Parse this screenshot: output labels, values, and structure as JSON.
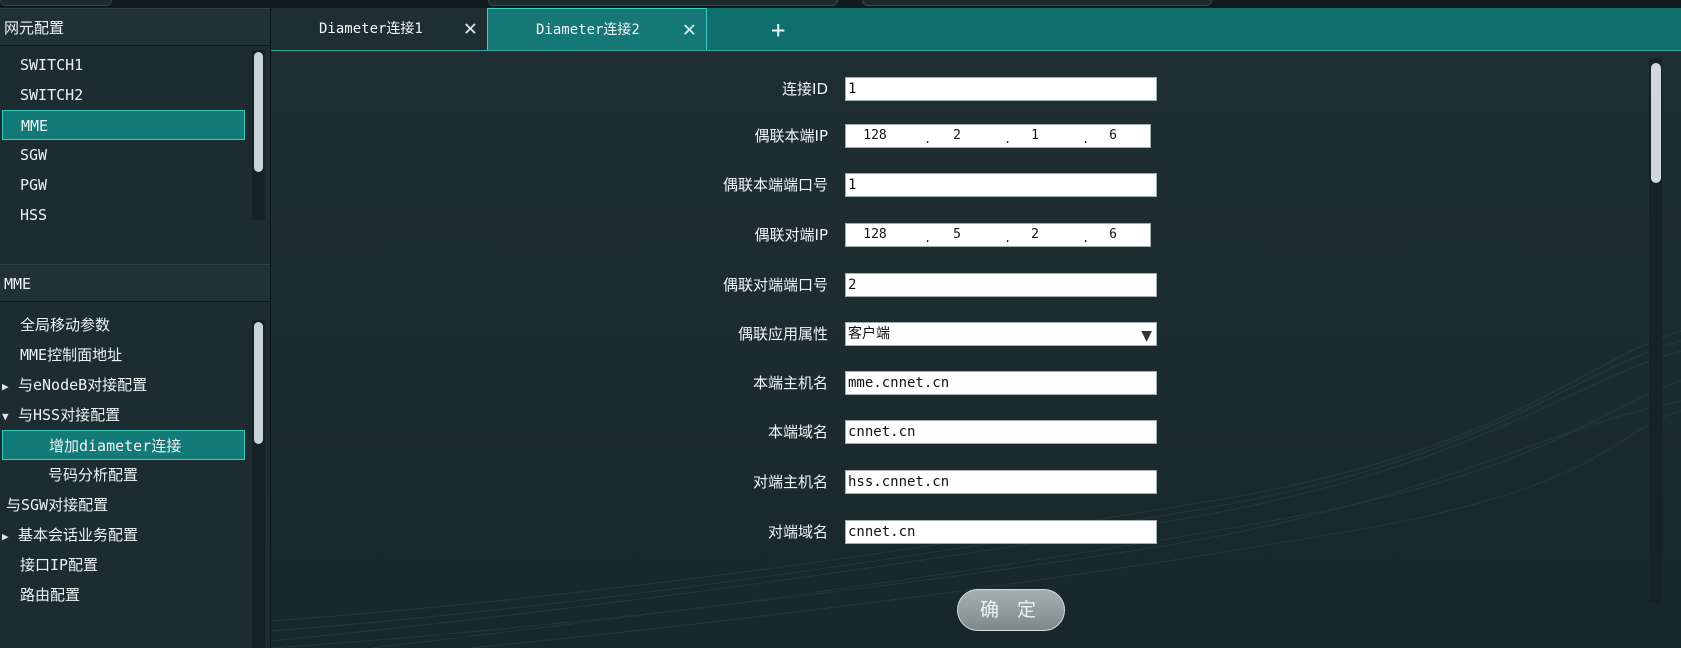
{
  "left_panel": {
    "ne_section": {
      "title": "网元配置",
      "items": [
        "SWITCH1",
        "SWITCH2",
        "MME",
        "SGW",
        "PGW",
        "HSS"
      ],
      "selected": "MME"
    },
    "mme_section": {
      "title": "MME",
      "items": [
        {
          "label": "全局移动参数",
          "arrow": ""
        },
        {
          "label": "MME控制面地址",
          "arrow": ""
        },
        {
          "label": "与eNodeB对接配置",
          "arrow": "▶"
        },
        {
          "label": "与HSS对接配置",
          "arrow": "▼"
        },
        {
          "label": "增加diameter连接",
          "arrow": ""
        },
        {
          "label": "号码分析配置",
          "arrow": ""
        },
        {
          "label": "与SGW对接配置",
          "arrow": ""
        },
        {
          "label": "基本会话业务配置",
          "arrow": "▶"
        },
        {
          "label": "接口IP配置",
          "arrow": ""
        },
        {
          "label": "路由配置",
          "arrow": ""
        }
      ],
      "selected": "增加diameter连接"
    }
  },
  "tabs": [
    {
      "label": "Diameter连接1",
      "close": "✕"
    },
    {
      "label": "Diameter连接2",
      "close": "✕"
    }
  ],
  "tab_add": "+",
  "form": {
    "conn_id": {
      "label": "连接ID",
      "value": "1"
    },
    "local_ip": {
      "label": "偶联本端IP",
      "octets": [
        "128",
        "2",
        "1",
        "6"
      ]
    },
    "local_port": {
      "label": "偶联本端端口号",
      "value": "1"
    },
    "peer_ip": {
      "label": "偶联对端IP",
      "octets": [
        "128",
        "5",
        "2",
        "6"
      ]
    },
    "peer_port": {
      "label": "偶联对端端口号",
      "value": "2"
    },
    "app_attr": {
      "label": "偶联应用属性",
      "value": "客户端"
    },
    "local_host": {
      "label": "本端主机名",
      "value": "mme.cnnet.cn"
    },
    "local_domain": {
      "label": "本端域名",
      "value": "cnnet.cn"
    },
    "peer_host": {
      "label": "对端主机名",
      "value": "hss.cnnet.cn"
    },
    "peer_domain": {
      "label": "对端域名",
      "value": "cnnet.cn"
    }
  },
  "confirm_button": "确 定"
}
